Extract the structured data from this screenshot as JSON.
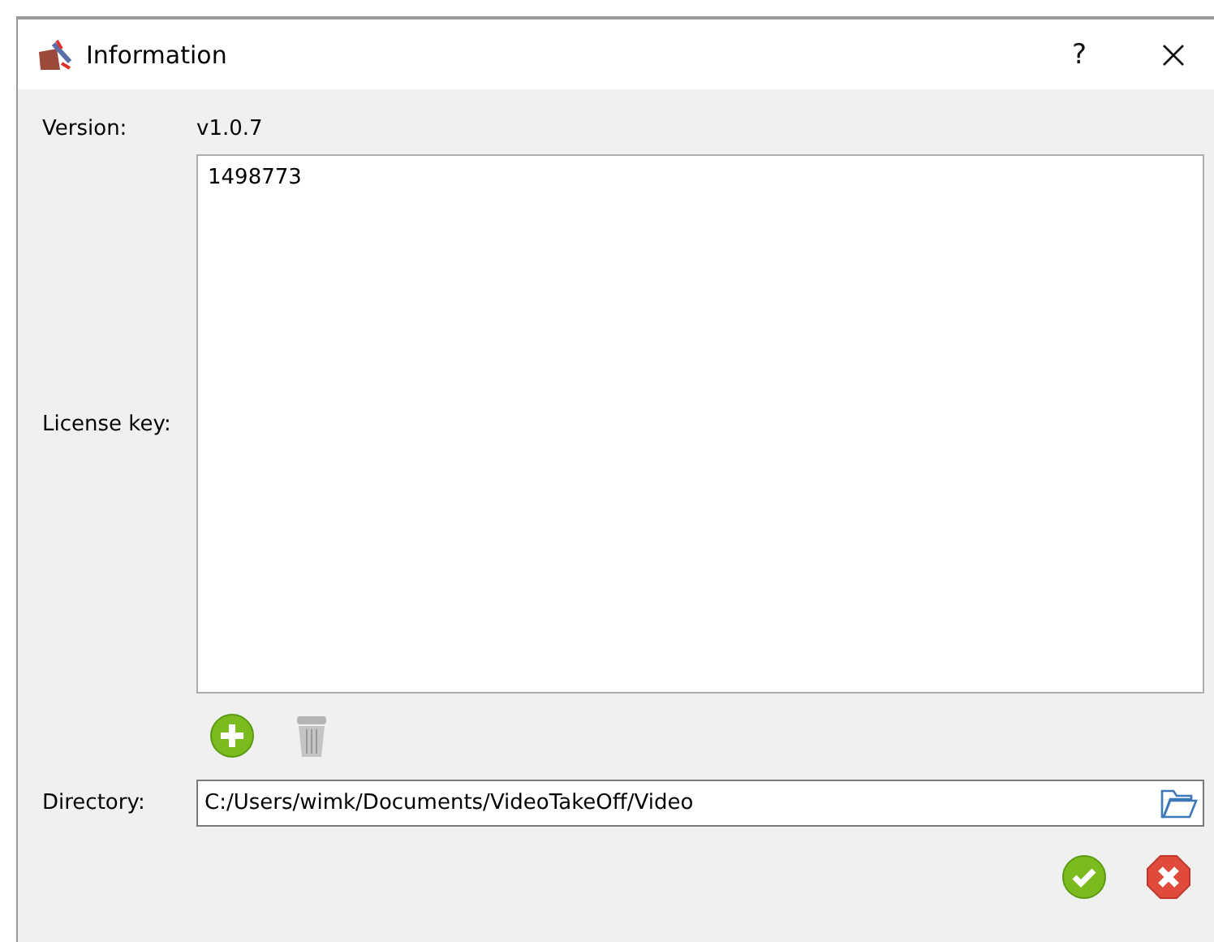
{
  "window": {
    "title": "Information",
    "help": "?"
  },
  "version": {
    "label": "Version:",
    "value": "v1.0.7"
  },
  "license": {
    "label": "License key:",
    "value": "1498773"
  },
  "directory": {
    "label": "Directory:",
    "value": "C:/Users/wimk/Documents/VideoTakeOff/Video"
  }
}
